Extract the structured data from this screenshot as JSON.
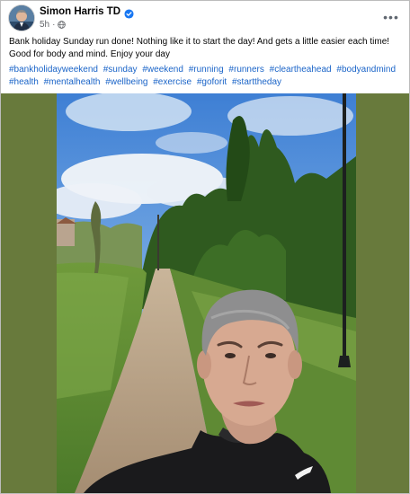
{
  "post": {
    "author": "Simon Harris TD",
    "timestamp": "5h",
    "verified_icon": "verified-badge-icon",
    "audience_icon": "globe-icon",
    "more_icon": "more-options-icon",
    "text_line1": "Bank holiday Sunday run done! Nothing like it to start the day! And gets a little easier each time!",
    "text_line2": "Good for body and mind. Enjoy your day",
    "hashtags": [
      "#bankholidayweekend",
      "#sunday",
      "#weekend",
      "#running",
      "#runners",
      "#cleartheahead",
      "#bodyandmind",
      "#health",
      "#mentalhealth",
      "#wellbeing",
      "#exercise",
      "#goforit",
      "#starttheday"
    ],
    "more_glyph": "•••"
  },
  "colors": {
    "hashtag": "#1a64c8",
    "verified": "#1877f2",
    "media_background": "#687a3c",
    "secondary_text": "#65676b"
  }
}
